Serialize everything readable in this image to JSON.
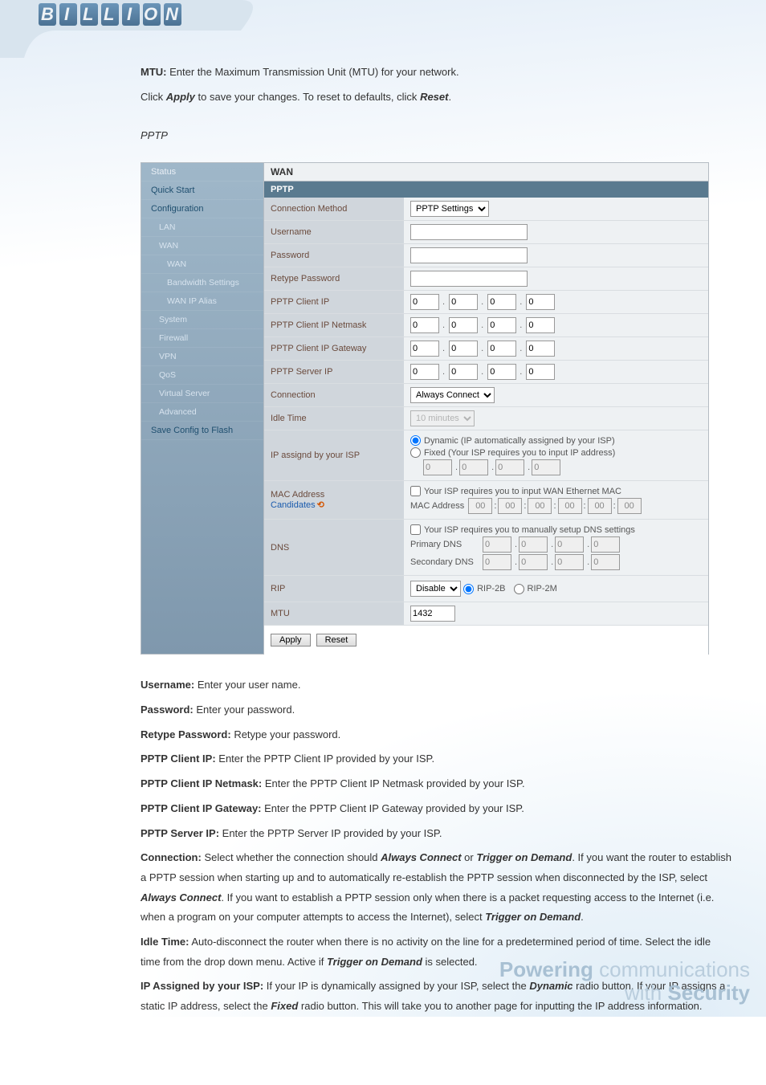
{
  "intro": {
    "mtu_label": "MTU:",
    "mtu_text": " Enter the Maximum Transmission Unit (MTU) for your network.",
    "click": "Click ",
    "apply": "Apply",
    "apply_after": " to save your changes. To reset to defaults, click ",
    "reset": "Reset",
    "period": "."
  },
  "pptp_heading": "PPTP",
  "screenshot": {
    "title1": "WAN",
    "title2": "PPTP",
    "sidebar": {
      "status": "Status",
      "quick_start": "Quick Start",
      "configuration": "Configuration",
      "lan": "LAN",
      "wan": "WAN",
      "wan2": "WAN",
      "bw": "Bandwidth Settings",
      "alias": "WAN IP Alias",
      "system": "System",
      "firewall": "Firewall",
      "vpn": "VPN",
      "qos": "QoS",
      "vs": "Virtual Server",
      "adv": "Advanced",
      "save": "Save Config to Flash"
    },
    "rows": {
      "conn_method": "Connection Method",
      "conn_method_val": "PPTP Settings",
      "username": "Username",
      "password": "Password",
      "retype": "Retype Password",
      "client_ip": "PPTP Client IP",
      "client_nm": "PPTP Client IP Netmask",
      "client_gw": "PPTP Client IP Gateway",
      "server_ip": "PPTP Server IP",
      "connection": "Connection",
      "connection_val": "Always Connect",
      "idle": "Idle Time",
      "idle_val": "10 minutes",
      "ip_assigned": "IP assignd by your ISP",
      "dyn_label": "Dynamic (IP automatically assigned by your ISP)",
      "fix_label": "Fixed (Your ISP requires you to input IP address)",
      "mac_row": "MAC Address",
      "candidates": "Candidates",
      "mac_check": "Your ISP requires you to input WAN Ethernet MAC",
      "mac_label": "MAC Address",
      "dns_row": "DNS",
      "dns_check": "Your ISP requires you to manually setup DNS settings",
      "primary_dns": "Primary DNS",
      "secondary_dns": "Secondary DNS",
      "rip": "RIP",
      "rip_val": "Disable",
      "rip2b": "RIP-2B",
      "rip2m": "RIP-2M",
      "mtu": "MTU",
      "mtu_val": "1432"
    },
    "ip_zero": "0",
    "mac_zero": "00",
    "buttons": {
      "apply": "Apply",
      "reset": "Reset"
    }
  },
  "desc": {
    "l1a": "Username:",
    "l1b": " Enter your user name.",
    "l2a": "Password:",
    "l2b": " Enter your password.",
    "l3a": "Retype Password:",
    "l3b": " Retype your password.",
    "l4a": "PPTP Client IP:",
    "l4b": " Enter the PPTP Client IP provided by your ISP.",
    "l5a": "PPTP Client IP Netmask:",
    "l5b": " Enter the PPTP Client IP Netmask provided by your ISP.",
    "l6a": "PPTP Client IP Gateway:",
    "l6b": " Enter the PPTP Client IP Gateway provided by your ISP.",
    "l7a": "PPTP Server IP:",
    "l7b": " Enter the PPTP Server IP provided by your ISP.",
    "l8a": "Connection:",
    "l8b": " Select whether the connection should ",
    "l8c": "Always Connect",
    "l8d": " or ",
    "l8e": "Trigger on Demand",
    "l8f": ". If you want the router to establish a PPTP session when starting up and to automatically re-establish the PPTP session when disconnected by the ISP, select ",
    "l8g": "Always Connect",
    "l8h": ". If you want to establish a PPTP session only when there is a packet requesting access to the Internet (i.e. when a program on your computer attempts to access the Internet), select ",
    "l8i": "Trigger on Demand",
    "l8j": ".",
    "l9a": "Idle Time:",
    "l9b": " Auto-disconnect the router when there is no activity on the line for a predetermined period of time. Select the idle time from the drop down menu. Active if ",
    "l9c": "Trigger on Demand",
    "l9d": " is selected.",
    "l10a": "IP Assigned by your ISP:",
    "l10b": " If your IP is dynamically assigned by your ISP, select the ",
    "l10c": "Dynamic",
    "l10d": " radio button. If your IP assigns a static IP address, select the ",
    "l10e": "Fixed",
    "l10f": " radio button. This will take you to another page for inputting the IP address information."
  },
  "slogan": {
    "p1": "Powering",
    "p2": " communications",
    "p3": "with ",
    "p4": "Security"
  }
}
